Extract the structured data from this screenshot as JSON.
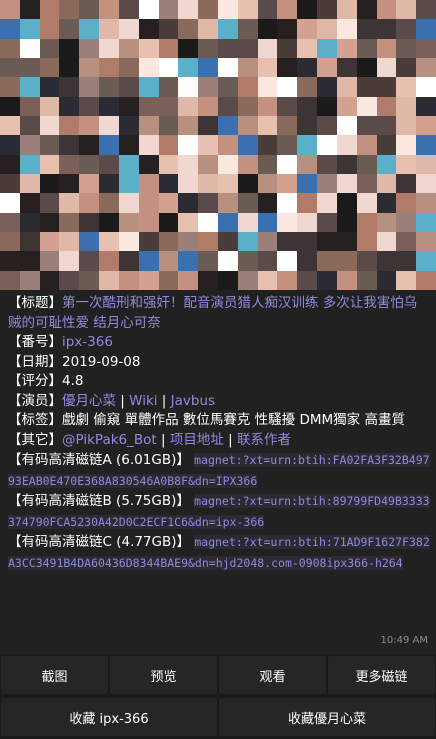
{
  "colors": {
    "message_bg": "#212121",
    "link": "#8f8ae0",
    "text": "#ffffff",
    "timestamp": "#8c8c8c",
    "button_bg": "#262626"
  },
  "thumbnail": {
    "description": "pixelated image",
    "palette": [
      "#2b2b33",
      "#5a4a4a",
      "#b07b68",
      "#e0b8a8",
      "#1a1a1a",
      "#8a6a5a",
      "#d4a090",
      "#3d3535",
      "#f0d8d0",
      "#6b5b55",
      "#c49080",
      "#262020",
      "#9a8078",
      "#e8c0b0",
      "#4a3c38",
      "#b89080",
      "#fbe8e0",
      "#7a6058",
      "#ffffff",
      "#3a6fb0",
      "#5ab0c8"
    ]
  },
  "message": {
    "title_label": "【标题】",
    "title": "第一次酷刑和强奸！配音演员猎人痴汉训练 多次让我害怕乌贼的可耻性爱 结月心可奈",
    "number_label": "【番号】",
    "number": "ipx-366",
    "date_label": "【日期】",
    "date": "2019-09-08",
    "rating_label": "【评分】",
    "rating": "4.8",
    "actor_label": "【演员】",
    "actor": "優月心菜",
    "actor_wiki": "Wiki",
    "actor_javbus": "Javbus",
    "sep": " | ",
    "tags_label": "【标签】",
    "tags": "戲劇 偷窺 單體作品 數位馬賽克 性騷擾 DMM獨家 高畫質",
    "other_label": "【其它】",
    "bot": "@PikPak6_Bot",
    "project": "项目地址",
    "contact": "联系作者",
    "magnet_a_label": "【有码高清磁链A (6.01GB)】",
    "magnet_a": "magnet:?xt=urn:btih:FA02FA3F32B49793EAB0E470E368A830546A0B8F&dn=IPX366",
    "magnet_b_label": "【有码高清磁链B (5.75GB)】",
    "magnet_b": "magnet:?xt=urn:btih:89799FD49B3333374790FCA5230A42D0C2ECF1C6&dn=ipx-366",
    "magnet_c_label": "【有码高清磁链C (4.77GB)】",
    "magnet_c": "magnet:?xt=urn:btih:71AD9F1627F382A3CC3491B4DA60436D8344BAE9&dn=hjd2048.com-0908ipx366-h264",
    "time": "10:49 AM"
  },
  "buttons": {
    "screenshot": "截图",
    "preview": "预览",
    "watch": "观看",
    "more_magnets": "更多磁链",
    "fav_code": "收藏 ipx-366",
    "fav_actor": "收藏優月心菜"
  }
}
